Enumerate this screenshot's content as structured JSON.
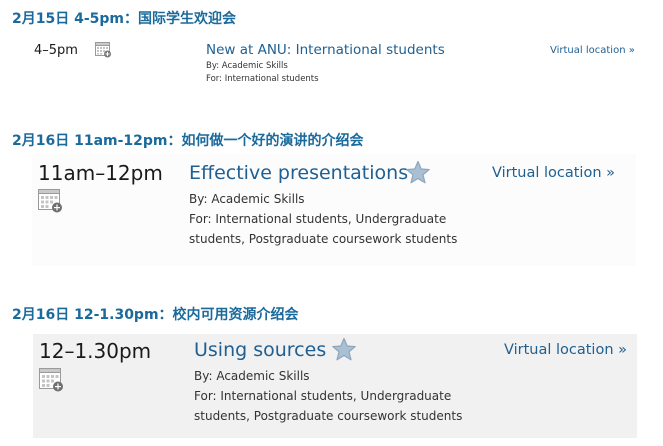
{
  "sections": [
    {
      "heading": "2月15日 4-5pm：国际学生欢迎会",
      "event": {
        "time": "4–5pm",
        "title": "New at ANU: International students",
        "by": "By: Academic Skills",
        "for": "For: International students",
        "location": "Virtual location »",
        "starred": false
      }
    },
    {
      "heading": "2月16日 11am-12pm：如何做一个好的演讲的介绍会",
      "event": {
        "time": "11am–12pm",
        "title": "Effective presentations",
        "by": "By: Academic Skills",
        "for_line1": "For: International students, Undergraduate",
        "for_line2": "students, Postgraduate coursework students",
        "location": "Virtual location »",
        "star_icon": "star-icon"
      }
    },
    {
      "heading": "2月16日 12-1.30pm：校内可用资源介绍会",
      "event": {
        "time": "12–1.30pm",
        "title": "Using sources",
        "by": "By: Academic Skills",
        "for_line1": "For: International students, Undergraduate",
        "for_line2": "students, Postgraduate coursework students",
        "location": "Virtual location »",
        "star_icon": "star-icon"
      }
    }
  ],
  "colors": {
    "heading": "#1b6a9c",
    "link": "#1f5f91",
    "star": "#a9bfd3"
  },
  "icons": {
    "calendar": "calendar-add-icon",
    "favorite": "star-icon"
  }
}
